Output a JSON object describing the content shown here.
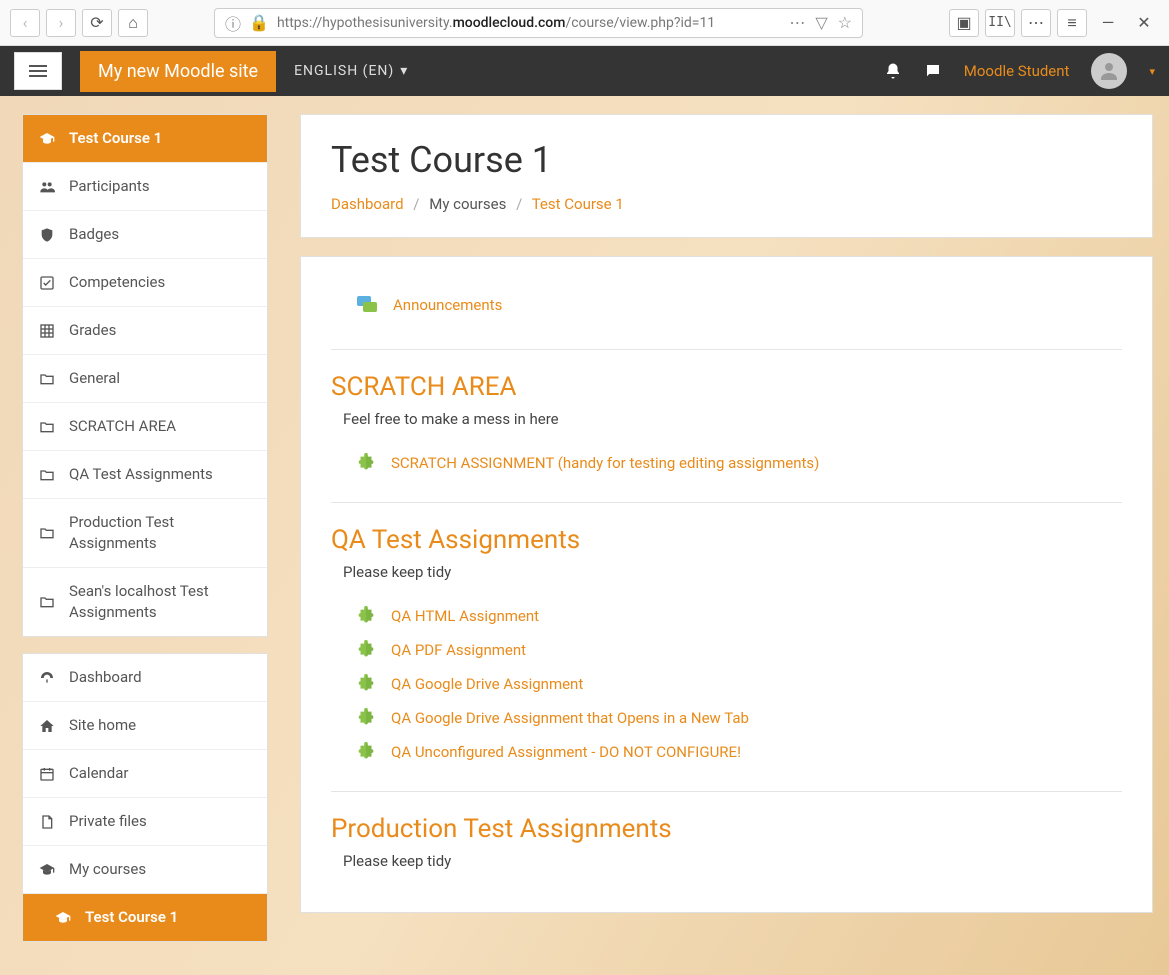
{
  "browser": {
    "url_prefix": "https://hypothesisuniversity.",
    "url_bold": "moodlecloud.com",
    "url_suffix": "/course/view.php?id=11"
  },
  "topbar": {
    "site_title": "My new Moodle site",
    "language": "ENGLISH (EN)",
    "user_name": "Moodle Student"
  },
  "sidebar": {
    "course_nav": [
      {
        "icon": "graduation",
        "label": "Test Course 1",
        "active": true
      },
      {
        "icon": "users",
        "label": "Participants"
      },
      {
        "icon": "shield",
        "label": "Badges"
      },
      {
        "icon": "check",
        "label": "Competencies"
      },
      {
        "icon": "grid",
        "label": "Grades"
      },
      {
        "icon": "folder",
        "label": "General"
      },
      {
        "icon": "folder",
        "label": "SCRATCH AREA"
      },
      {
        "icon": "folder",
        "label": "QA Test Assignments"
      },
      {
        "icon": "folder",
        "label": "Production Test Assignments"
      },
      {
        "icon": "folder",
        "label": "Sean's localhost Test Assignments"
      }
    ],
    "site_nav": [
      {
        "icon": "dashboard",
        "label": "Dashboard"
      },
      {
        "icon": "home",
        "label": "Site home"
      },
      {
        "icon": "calendar",
        "label": "Calendar"
      },
      {
        "icon": "file",
        "label": "Private files"
      },
      {
        "icon": "graduation",
        "label": "My courses"
      },
      {
        "icon": "graduation",
        "label": "Test Course 1",
        "active": true,
        "indent": true
      }
    ]
  },
  "main": {
    "title": "Test Course 1",
    "breadcrumb": {
      "dashboard": "Dashboard",
      "my_courses": "My courses",
      "current": "Test Course 1"
    },
    "intro_activity": {
      "label": "Announcements"
    },
    "sections": [
      {
        "heading": "SCRATCH AREA",
        "desc": "Feel free to make a mess in here",
        "activities": [
          {
            "label": "SCRATCH ASSIGNMENT (handy for testing editing assignments)"
          }
        ]
      },
      {
        "heading": "QA Test Assignments",
        "desc": "Please keep tidy",
        "activities": [
          {
            "label": "QA HTML Assignment"
          },
          {
            "label": "QA PDF Assignment"
          },
          {
            "label": "QA Google Drive Assignment"
          },
          {
            "label": "QA Google Drive Assignment that Opens in a New Tab"
          },
          {
            "label": "QA Unconfigured Assignment - DO NOT CONFIGURE!"
          }
        ]
      },
      {
        "heading": "Production Test Assignments",
        "desc": "Please keep tidy",
        "activities": []
      }
    ]
  }
}
